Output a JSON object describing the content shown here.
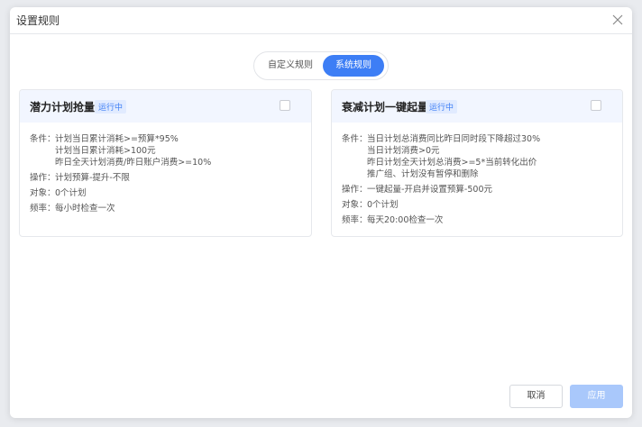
{
  "dialog": {
    "title": "设置规则",
    "close_icon": "close-icon"
  },
  "toggle": {
    "custom_label": "自定义规则",
    "system_label": "系统规则",
    "selected": "系统规则"
  },
  "colors": {
    "accent": "#3d7ef5",
    "card_header_bg": "#f2f6ff",
    "apply_disabled": "#a9c8fb"
  },
  "rules": [
    {
      "title": "潜力计划抢量",
      "status": "运行中",
      "condition_label": "条件：",
      "conditions": [
        "计划当日累计消耗>=预算*95%",
        "计划当日累计消耗>100元",
        "昨日全天计划消费/昨日账户消费>=10%"
      ],
      "operation_label": "操作：",
      "operation": "计划预算-提升-不限",
      "target_label": "对象：",
      "target": "0个计划",
      "frequency_label": "频率：",
      "frequency": "每小时检查一次"
    },
    {
      "title": "衰减计划一键起量",
      "status": "运行中",
      "condition_label": "条件：",
      "conditions": [
        "当日计划总消费同比昨日同时段下降超过30%",
        "当日计划消费>0元",
        "昨日计划全天计划总消费>=5*当前转化出价",
        "推广组、计划没有暂停和删除"
      ],
      "operation_label": "操作：",
      "operation": "一键起量-开启并设置预算-500元",
      "target_label": "对象：",
      "target": "0个计划",
      "frequency_label": "频率：",
      "frequency": "每天20:00检查一次"
    }
  ],
  "footer": {
    "cancel_label": "取消",
    "apply_label": "应用"
  }
}
